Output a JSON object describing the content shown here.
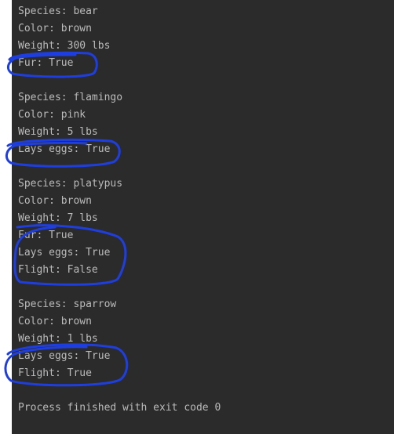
{
  "console": {
    "blocks": [
      {
        "species": "Species: bear",
        "color": "Color: brown",
        "weight": "Weight: 300 lbs",
        "traits": [
          "Fur: True"
        ]
      },
      {
        "species": "Species: flamingo",
        "color": "Color: pink",
        "weight": "Weight: 5 lbs",
        "traits": [
          "Lays eggs: True"
        ]
      },
      {
        "species": "Species: platypus",
        "color": "Color: brown",
        "weight": "Weight: 7 lbs",
        "traits": [
          "Fur: True",
          "Lays eggs: True",
          "Flight: False"
        ]
      },
      {
        "species": "Species: sparrow",
        "color": "Color: brown",
        "weight": "Weight: 1 lbs",
        "traits": [
          "Lays eggs: True",
          "Flight: True"
        ]
      }
    ],
    "footer": "Process finished with exit code 0"
  },
  "annotation_color": "#1f3ee0"
}
